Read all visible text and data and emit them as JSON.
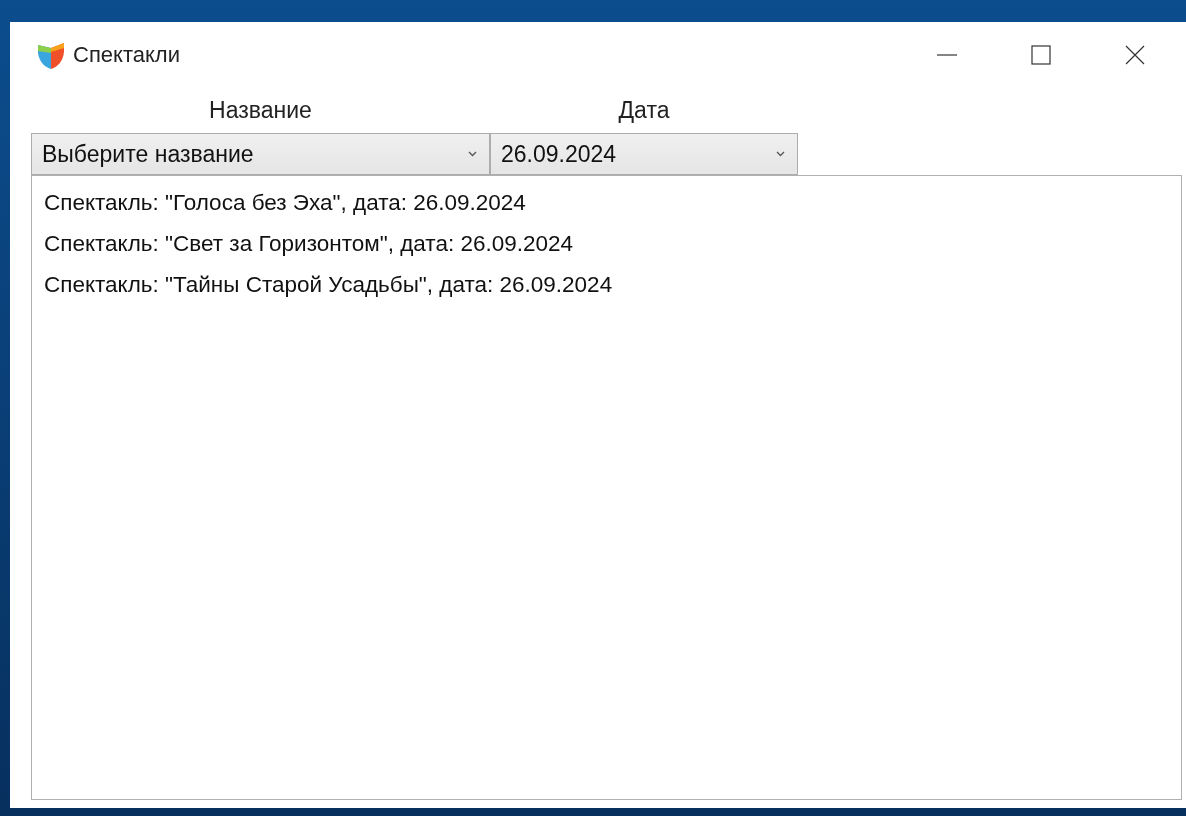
{
  "window": {
    "title": "Спектакли"
  },
  "filters": [
    {
      "label": "Название",
      "value": "Выберите название"
    },
    {
      "label": "Дата",
      "value": "26.09.2024"
    }
  ],
  "list": {
    "items": [
      "Спектакль: \"Голоса без Эха\", дата: 26.09.2024",
      "Спектакль: \"Свет за Горизонтом\", дата: 26.09.2024",
      "Спектакль: \"Тайны Старой Усадьбы\", дата: 26.09.2024"
    ]
  }
}
